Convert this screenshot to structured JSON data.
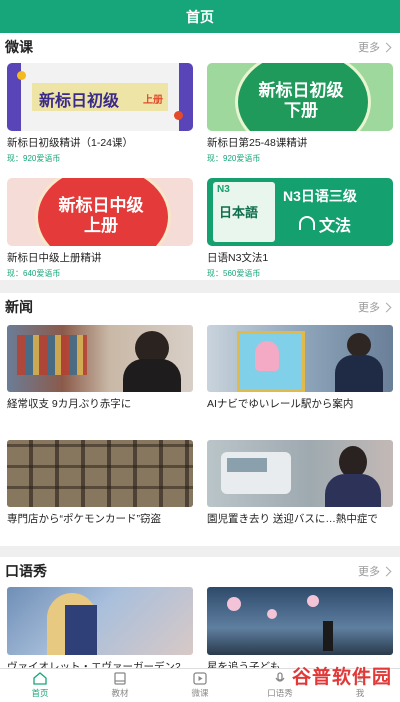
{
  "header": {
    "title": "首页"
  },
  "colors": {
    "accent": "#17a679",
    "price": "#17a679"
  },
  "weike": {
    "title": "微课",
    "more": "更多",
    "courses": [
      {
        "banner": "新标日初级",
        "banner_sub": "上册",
        "title": "新标日初级精讲（1-24课）",
        "price": "现：920爱语币"
      },
      {
        "banner": "新标日初级下册",
        "title": "新标日第25-48课精讲",
        "price": "现：920爱语币"
      },
      {
        "banner": "新标日中级上册",
        "title": "新标日中级上册精讲",
        "price": "现：640爱语币"
      },
      {
        "banner_left": "N3",
        "banner_book": "日本語",
        "banner": "N3日语三级",
        "banner2": "文法",
        "title": "日语N3文法1",
        "price": "现：560爱语币"
      }
    ]
  },
  "news": {
    "title": "新闻",
    "more": "更多",
    "items": [
      {
        "title": "経常収支 9カ月ぶり赤字に"
      },
      {
        "title": "AIナビでゆいレール駅から案内"
      },
      {
        "title": "専門店から“ポケモンカード”窃盗"
      },
      {
        "title": "園児置き去り 送迎バスに…熱中症で"
      }
    ]
  },
  "kouyu": {
    "title": "口语秀",
    "more": "更多",
    "items": [
      {
        "title": "ヴァイオレット・エヴァーガーデン2"
      },
      {
        "title": "星を追う子ども"
      }
    ]
  },
  "tabbar": {
    "tabs": [
      {
        "label": "首页",
        "icon": "home-icon"
      },
      {
        "label": "教材",
        "icon": "book-icon"
      },
      {
        "label": "微课",
        "icon": "play-icon"
      },
      {
        "label": "口语秀",
        "icon": "mic-icon"
      },
      {
        "label": "我",
        "icon": "user-icon"
      }
    ]
  },
  "watermark": "谷普软件园"
}
